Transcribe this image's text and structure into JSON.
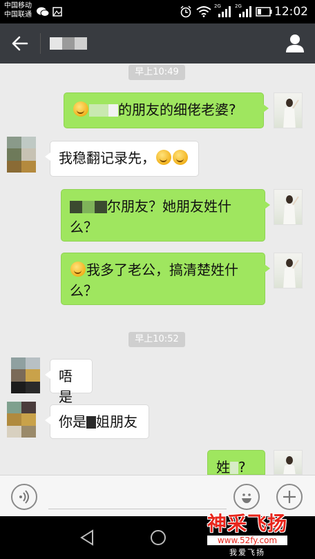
{
  "status_bar": {
    "carrier_1": "中国移动",
    "carrier_2": "中国联通",
    "signal_1_label": "2G",
    "signal_2_label": "2G",
    "time": "12:02",
    "icons": [
      "wechat-icon",
      "image-icon",
      "alarm-icon",
      "wifi-icon",
      "signal-icon",
      "signal-icon",
      "battery-icon"
    ]
  },
  "header": {
    "back_icon": "arrow-left-icon",
    "profile_icon": "person-icon",
    "title_pixelated": true
  },
  "timestamps": [
    "早上10:49",
    "早上10:52"
  ],
  "messages": [
    {
      "sender": "me",
      "text": "的朋友的细佬老婆?",
      "prefix_emoji": "grin-emoji"
    },
    {
      "sender": "them",
      "text": "我稳翻记录先，",
      "suffix_emoji": "thinking-emoji x2"
    },
    {
      "sender": "me",
      "text_line1": "尔朋友？她朋友姓什",
      "text_line2": "么？"
    },
    {
      "sender": "me",
      "text_line1": "我多了老公，搞清楚姓什",
      "text_line2": "么？",
      "prefix_emoji": "thinking-emoji"
    },
    {
      "sender": "them",
      "text": "唔是"
    },
    {
      "sender": "them",
      "text_a": "你是",
      "text_b": "姐朋友"
    },
    {
      "sender": "me",
      "text_a": "姓",
      "text_b": "?"
    }
  ],
  "input_bar": {
    "voice_icon": "voice-icon",
    "emoji_icon": "smiley-icon",
    "plus_icon": "plus-icon",
    "placeholder": ""
  },
  "nav_bar": {
    "icons": [
      "back-triangle-icon",
      "home-circle-icon"
    ]
  },
  "watermark": {
    "title": "神采飞扬",
    "url": "www.52fy.com",
    "sub": "我爱飞扬"
  },
  "colors": {
    "header_bg": "#383b40",
    "chat_bg": "#ebebeb",
    "my_bubble": "#9fe65f",
    "their_bubble": "#ffffff",
    "watermark_red": "#e8261c"
  }
}
